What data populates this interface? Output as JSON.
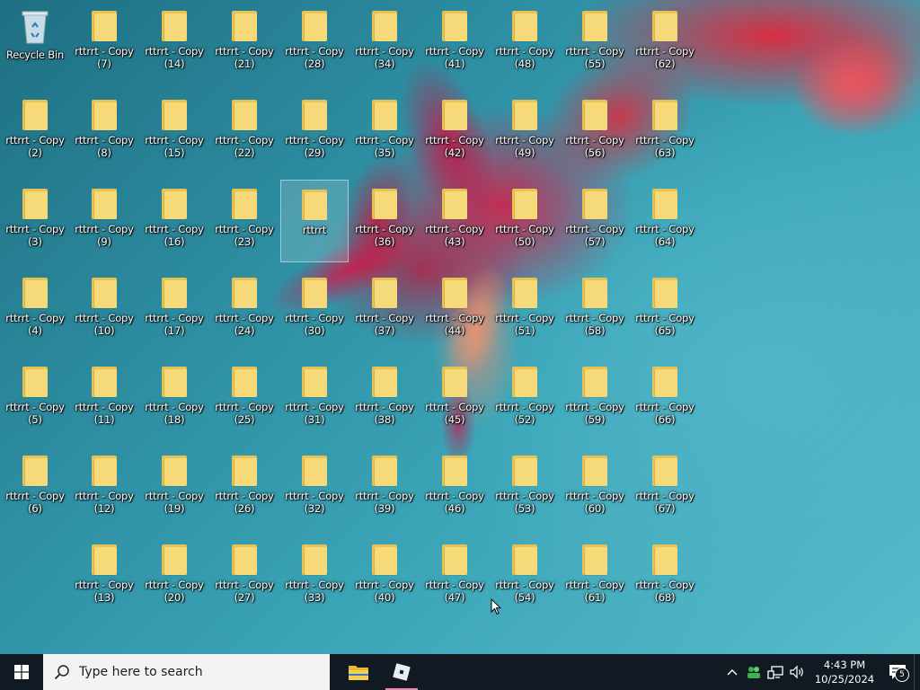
{
  "desktop": {
    "recycle_bin": {
      "label": "Recycle Bin",
      "icon": "recycle-bin-icon"
    },
    "folder_icon": "folder-icon",
    "columns": [
      [
        "rttrrt - Copy\n(2)",
        "rttrrt - Copy\n(3)",
        "rttrrt - Copy\n(4)",
        "rttrrt - Copy\n(5)",
        "rttrrt - Copy\n(6)"
      ],
      [
        "rttrrt - Copy\n(7)",
        "rttrrt - Copy\n(8)",
        "rttrrt - Copy\n(9)",
        "rttrrt - Copy\n(10)",
        "rttrrt - Copy\n(11)",
        "rttrrt - Copy\n(12)",
        "rttrrt - Copy\n(13)"
      ],
      [
        "rttrrt - Copy\n(14)",
        "rttrrt - Copy\n(15)",
        "rttrrt - Copy\n(16)",
        "rttrrt - Copy\n(17)",
        "rttrrt - Copy\n(18)",
        "rttrrt - Copy\n(19)",
        "rttrrt - Copy\n(20)"
      ],
      [
        "rttrrt - Copy\n(21)",
        "rttrrt - Copy\n(22)",
        "rttrrt - Copy\n(23)",
        "rttrrt - Copy\n(24)",
        "rttrrt - Copy\n(25)",
        "rttrrt - Copy\n(26)",
        "rttrrt - Copy\n(27)"
      ],
      [
        "rttrrt - Copy\n(28)",
        "rttrrt - Copy\n(29)",
        "rttrrt",
        "rttrrt - Copy\n(30)",
        "rttrrt - Copy\n(31)",
        "rttrrt - Copy\n(32)",
        "rttrrt - Copy\n(33)"
      ],
      [
        "rttrrt - Copy\n(34)",
        "rttrrt - Copy\n(35)",
        "rttrrt - Copy\n(36)",
        "rttrrt - Copy\n(37)",
        "rttrrt - Copy\n(38)",
        "rttrrt - Copy\n(39)",
        "rttrrt - Copy\n(40)"
      ],
      [
        "rttrrt - Copy\n(41)",
        "rttrrt - Copy\n(42)",
        "rttrrt - Copy\n(43)",
        "rttrrt - Copy\n(44)",
        "rttrrt - Copy\n(45)",
        "rttrrt - Copy\n(46)",
        "rttrrt - Copy\n(47)"
      ],
      [
        "rttrrt - Copy\n(48)",
        "rttrrt - Copy\n(49)",
        "rttrrt - Copy\n(50)",
        "rttrrt - Copy\n(51)",
        "rttrrt - Copy\n(52)",
        "rttrrt - Copy\n(53)",
        "rttrrt - Copy\n(54)"
      ],
      [
        "rttrrt - Copy\n(55)",
        "rttrrt - Copy\n(56)",
        "rttrrt - Copy\n(57)",
        "rttrrt - Copy\n(58)",
        "rttrrt - Copy\n(59)",
        "rttrrt - Copy\n(60)",
        "rttrrt - Copy\n(61)"
      ],
      [
        "rttrrt - Copy\n(62)",
        "rttrrt - Copy\n(63)",
        "rttrrt - Copy\n(64)",
        "rttrrt - Copy\n(65)",
        "rttrrt - Copy\n(66)",
        "rttrrt - Copy\n(67)",
        "rttrrt - Copy\n(68)"
      ]
    ],
    "selected_label": "rttrrt"
  },
  "taskbar": {
    "start_icon": "windows-logo-icon",
    "search": {
      "placeholder": "Type here to search",
      "icon": "search-icon"
    },
    "pinned_apps": [
      {
        "name": "file-explorer",
        "icon": "folder-icon",
        "active": false
      },
      {
        "name": "roblox",
        "icon": "roblox-icon",
        "active": true
      }
    ],
    "tray": {
      "icons": [
        "chevron-up-icon",
        "network-people-icon",
        "network-icon",
        "volume-icon"
      ],
      "time": "4:43 PM",
      "date": "10/25/2024",
      "notification_count": "5",
      "notification_icon": "action-center-icon"
    }
  },
  "colors": {
    "taskbar_bg": "#111a22",
    "folder_yellow": "#f6d978",
    "accent_active": "#e98aa8",
    "wallpaper_teal": "#3aa4b6",
    "wallpaper_pink": "#d71e46"
  }
}
